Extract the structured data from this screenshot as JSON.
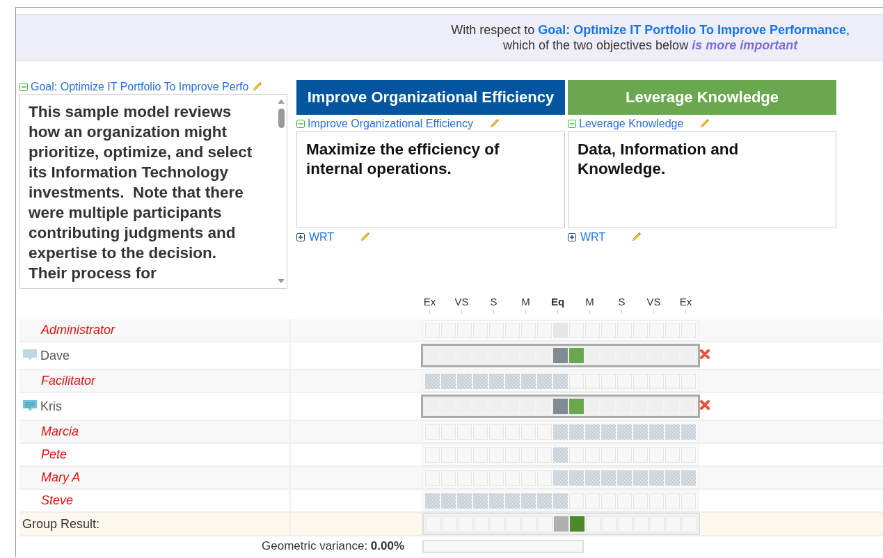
{
  "header": {
    "prefix": "With respect to",
    "goal_link": "Goal: Optimize IT Portfolio To Improve Performance",
    "suffix": ",",
    "line2": "which of the two objectives below",
    "emphasis": "is more important"
  },
  "goal": {
    "label": "Goal: Optimize IT Portfolio To Improve Perfo",
    "expanded": true,
    "description": "This sample model reviews how an organization might prioritize, optimize, and select its Information Technology investments.  Note that there were multiple participants contributing judgments and expertise to the decision.  Their process for"
  },
  "objectives": [
    {
      "title": "Improve Organizational Efficiency",
      "color": "#02559e",
      "label": "Improve Organizational Efficiency",
      "expanded": true,
      "description": "Maximize the efficiency of internal operations.",
      "wrt": "WRT",
      "wrt_expanded": false
    },
    {
      "title": "Leverage Knowledge",
      "color": "#6aa84f",
      "label": "Leverage Knowledge",
      "expanded": true,
      "description": "Data, Information and Knowledge.",
      "wrt": "WRT",
      "wrt_expanded": false
    }
  ],
  "scale": [
    "Ex",
    "VS",
    "S",
    "M",
    "Eq",
    "M",
    "S",
    "VS",
    "Ex"
  ],
  "participants": [
    {
      "name": "Administrator",
      "kind": "other"
    },
    {
      "name": "Dave",
      "kind": "own",
      "has_comment": false,
      "level": 0.5625
    },
    {
      "name": "Facilitator",
      "kind": "other",
      "level": 0
    },
    {
      "name": "Kris",
      "kind": "own",
      "has_comment": true,
      "level": 0.5625
    },
    {
      "name": "Marcia",
      "kind": "other",
      "level": 1
    },
    {
      "name": "Pete",
      "kind": "other",
      "level": 0.5
    },
    {
      "name": "Mary A",
      "kind": "other",
      "level": 1
    },
    {
      "name": "Steve",
      "kind": "other",
      "level": 0
    }
  ],
  "group_result": {
    "label": "Group Result:",
    "level": 0.5625
  },
  "variance": {
    "text": "Geometric variance: **0.00%**",
    "level": 0
  }
}
